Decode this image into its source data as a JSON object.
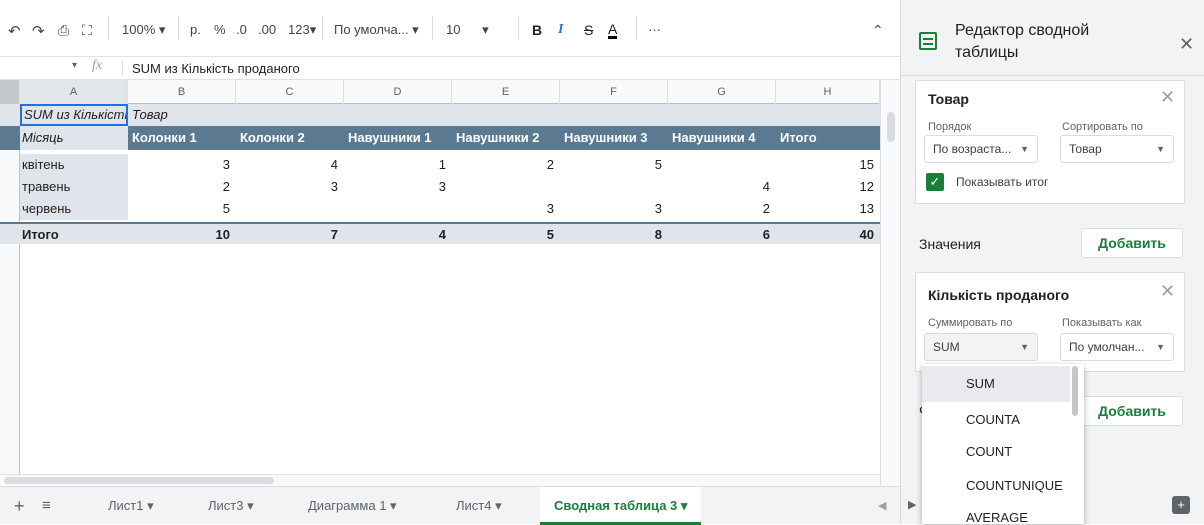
{
  "toolbar": {
    "zoom": "100%",
    "currency": "р.",
    "percent": "%",
    "dec_less": ".0",
    "dec_more": ".00",
    "format_more": "123",
    "font": "По умолча...",
    "font_size": "10",
    "bold": "B",
    "italic": "I",
    "strike": "S",
    "text_color": "A",
    "more": "···"
  },
  "formula_bar": {
    "fx": "fx",
    "content": "SUM из Кількість проданого"
  },
  "columns": [
    "A",
    "B",
    "C",
    "D",
    "E",
    "F",
    "G",
    "H"
  ],
  "pivot": {
    "a1": "SUM из Кількість проданого",
    "b1": "Товар",
    "header": [
      "Місяць",
      "Колонки 1",
      "Колонки 2",
      "Навушники 1",
      "Навушники 2",
      "Навушники 3",
      "Навушники 4",
      "Итого"
    ],
    "rows": [
      {
        "label": "квітень",
        "values": [
          "3",
          "4",
          "1",
          "2",
          "5",
          "",
          "15"
        ]
      },
      {
        "label": "травень",
        "values": [
          "2",
          "3",
          "3",
          "",
          "",
          "4",
          "12"
        ]
      },
      {
        "label": "червень",
        "values": [
          "5",
          "",
          "",
          "3",
          "3",
          "2",
          "13"
        ]
      }
    ],
    "total": {
      "label": "Итого",
      "values": [
        "10",
        "7",
        "4",
        "5",
        "8",
        "6",
        "40"
      ]
    }
  },
  "tabs": [
    {
      "label": "Лист1 ▾"
    },
    {
      "label": "Лист3 ▾"
    },
    {
      "label": "Диаграмма 1 ▾"
    },
    {
      "label": "Лист4 ▾"
    },
    {
      "label": "Сводная таблица 3 ▾"
    }
  ],
  "editor": {
    "title": "Редактор сводной таблицы",
    "rows_card": {
      "title": "Товар",
      "order_label": "Порядок",
      "order_value": "По возраста...",
      "sort_label": "Сортировать по",
      "sort_value": "Товар",
      "show_totals": "Показывать итог"
    },
    "values_label": "Значения",
    "add_label": "Добавить",
    "values_card": {
      "title": "Кількість проданого",
      "summarize_label": "Суммировать по",
      "summarize_value": "SUM",
      "show_as_label": "Показывать как",
      "show_as_value": "По умолчан..."
    },
    "filters_partial": "Ф",
    "add2_label": "Добавить",
    "dropdown": [
      "SUM",
      "COUNTA",
      "COUNT",
      "COUNTUNIQUE",
      "AVERAGE"
    ]
  },
  "colors": {
    "accent": "#188038",
    "pivot_header": "#5b7a92",
    "pivot_light": "#dfe5ea"
  }
}
